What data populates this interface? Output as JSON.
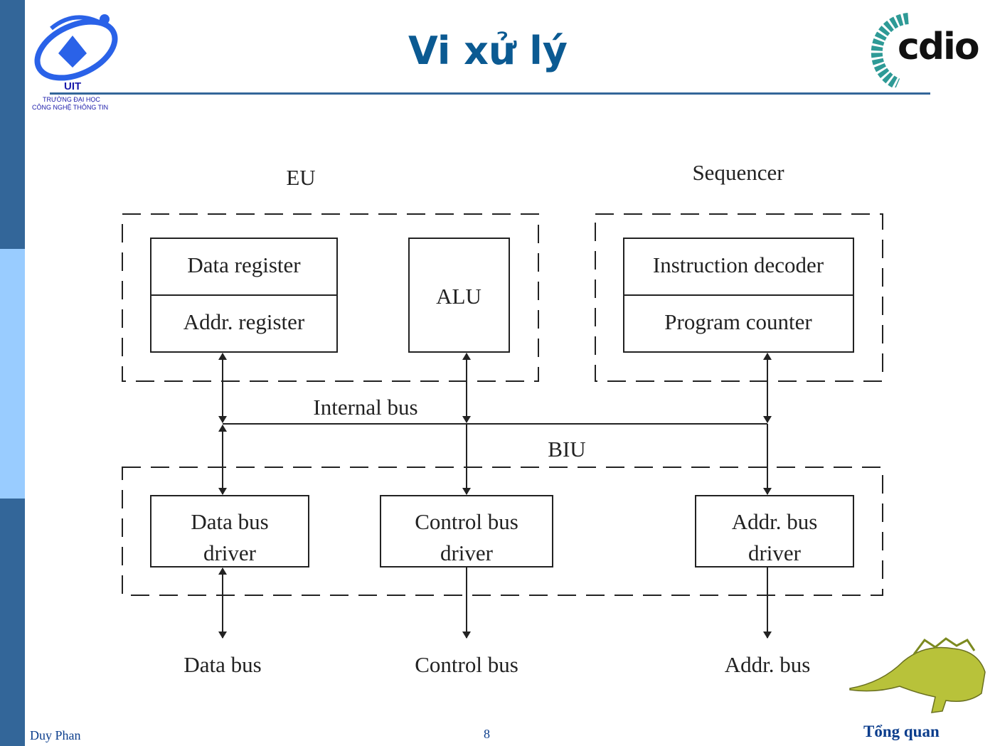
{
  "header": {
    "title": "Vi xử lý",
    "logo_left": {
      "name": "UIT",
      "line1": "TRƯỜNG ĐẠI HỌC",
      "line2": "CÔNG NGHỆ THÔNG TIN"
    },
    "logo_right": "cdio"
  },
  "diagram": {
    "eu_label": "EU",
    "sequencer_label": "Sequencer",
    "data_register": "Data register",
    "addr_register": "Addr. register",
    "alu": "ALU",
    "instruction_decoder": "Instruction decoder",
    "program_counter": "Program counter",
    "internal_bus": "Internal bus",
    "biu_label": "BIU",
    "data_bus_driver": [
      "Data bus",
      "driver"
    ],
    "control_bus_driver": [
      "Control bus",
      "driver"
    ],
    "addr_bus_driver": [
      "Addr. bus",
      "driver"
    ],
    "data_bus": "Data bus",
    "control_bus": "Control bus",
    "addr_bus": "Addr. bus"
  },
  "footer": {
    "author": "Duy Phan",
    "page": "8",
    "section": "Tổng quan"
  },
  "colors": {
    "sidebar_dark": "#336699",
    "sidebar_light": "#99ccff",
    "title": "#0b5a92",
    "uit_blue": "#2a62e8",
    "cdio_teal": "#2e9a96"
  }
}
